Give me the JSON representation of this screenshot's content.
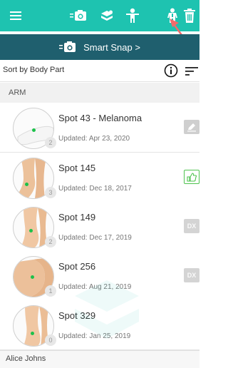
{
  "toolbar": {
    "icons": [
      "menu-icon",
      "camera-icon",
      "apps-icon",
      "body-front-icon",
      "body-back-icon",
      "trash-icon"
    ],
    "color": "#1ec3b0"
  },
  "banner": {
    "label": "Smart Snap >",
    "color": "#1f5f6e"
  },
  "sort": {
    "label": "Sort by Body Part"
  },
  "section": {
    "label": "ARM"
  },
  "spots": [
    {
      "name": "Spot 43 - Melanoma",
      "updated": "Updated: Apr 23, 2020",
      "count": "2",
      "action": "edit-icon"
    },
    {
      "name": "Spot 145",
      "updated": "Updated: Dec 18, 2017",
      "count": "3",
      "action": "thumbs-up-icon"
    },
    {
      "name": "Spot 149",
      "updated": "Updated: Dec 17, 2019",
      "count": "2",
      "action": "DX"
    },
    {
      "name": "Spot 256",
      "updated": "Updated: Aug 21, 2019",
      "count": "1",
      "action": "DX"
    },
    {
      "name": "Spot 329",
      "updated": "Updated: Jan 25, 2019",
      "count": "0",
      "action": ""
    }
  ],
  "footer": {
    "name": "Alice Johns"
  }
}
